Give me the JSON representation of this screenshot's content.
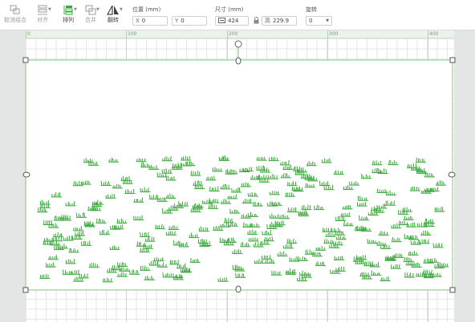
{
  "toolbar": {
    "ungroup_label": "取消组合",
    "align_label": "对齐",
    "arrange_label": "排列",
    "merge_label": "合并",
    "flip_label": "翻转",
    "position": {
      "title": "位置 (mm)",
      "x_prefix": "X",
      "x_value": "0",
      "y_prefix": "Y",
      "y_value": "0"
    },
    "size": {
      "title": "尺寸 (mm)",
      "width_value": "424",
      "height_prefix": "高",
      "height_value": "229.9"
    },
    "rotate": {
      "title": "旋转",
      "value": "0"
    }
  },
  "ruler": {
    "labels": [
      "0",
      "100",
      "200",
      "300",
      "400"
    ]
  },
  "icons": [
    "ungroup-icon",
    "align-icon",
    "arrange-icon",
    "merge-icon",
    "flip-icon",
    "width-icon",
    "lock-icon",
    "rotate-handle-icon"
  ],
  "colors": {
    "accent": "#7cc97c",
    "grass": "#3aa83a",
    "selection": "#7cc97c"
  }
}
